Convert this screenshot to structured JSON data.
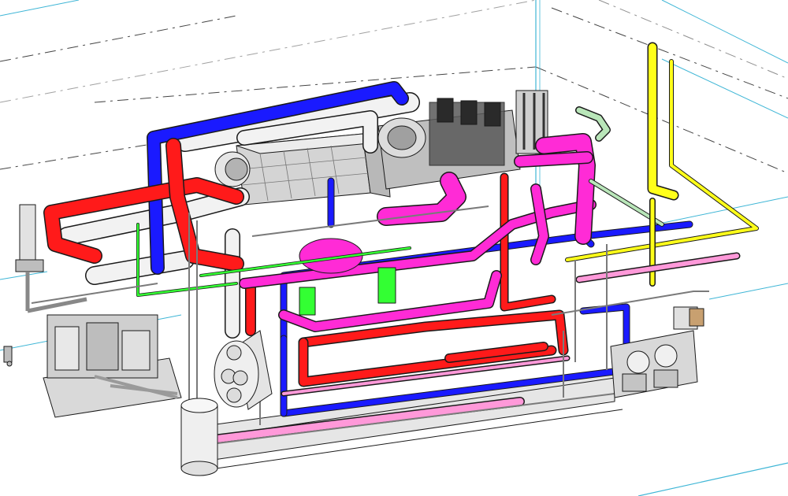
{
  "scene": {
    "description_visible_text": "",
    "colors": {
      "background": "#ffffff",
      "grid_cyan": "#3fb6d6",
      "grid_dash": "#444444",
      "pipe_red": "#ff1a1a",
      "pipe_blue": "#1a1aff",
      "pipe_magenta": "#ff2bd6",
      "pipe_white": "#f2f2f2",
      "pipe_yellow": "#ffff1a",
      "pipe_green": "#33ff33",
      "pipe_pink": "#ff99d9",
      "pipe_grey": "#b0b0b0",
      "equipment_grey": "#c8c8c8",
      "outline": "#1a1a1a"
    },
    "components": [
      "reference-grid",
      "red-pipe-loop",
      "blue-pipe-loop",
      "magenta-pipe-run",
      "white-insulated-pipe",
      "yellow-vent-riser",
      "green-pipe-run",
      "pink-drain-line",
      "grey-utility-lines",
      "main-engine-block",
      "heat-exchanger-box",
      "vertical-tank",
      "horizontal-receiver",
      "skid-base",
      "pump-skid",
      "electrical-cabinet"
    ]
  }
}
